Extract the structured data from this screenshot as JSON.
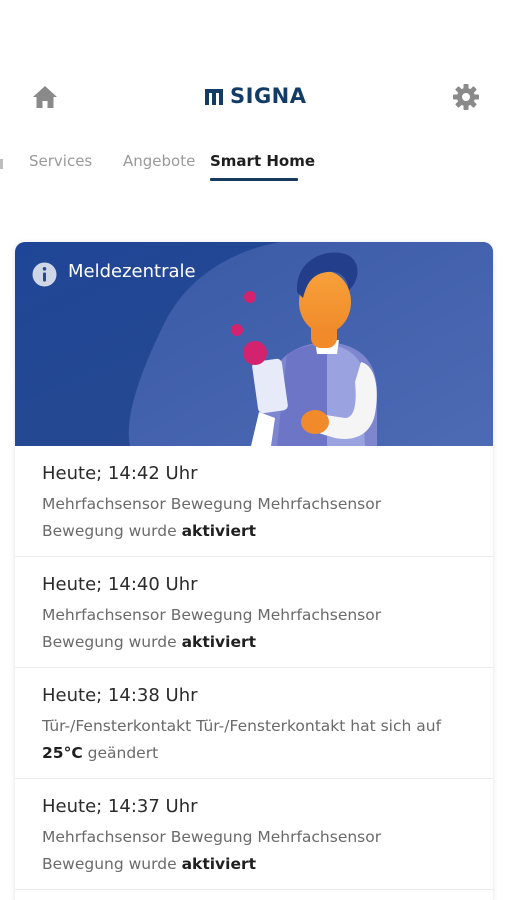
{
  "header": {
    "brand": "SIGNA",
    "home_icon": "home-icon",
    "settings_icon": "gear-icon",
    "brand_color": "#123c66"
  },
  "tabs": [
    {
      "label": "Services",
      "active": false
    },
    {
      "label": "Angebote",
      "active": false
    },
    {
      "label": "Smart Home",
      "active": true
    }
  ],
  "card": {
    "title": "Meldezentrale",
    "title_icon": "info-icon",
    "banner_color": "#2a4a8e"
  },
  "notifications": [
    {
      "time": "Heute; 14:42 Uhr",
      "text": "Mehrfachsensor Bewegung Mehrfachsensor Bewegung wurde",
      "highlight": "aktiviert",
      "suffix": ""
    },
    {
      "time": "Heute; 14:40 Uhr",
      "text": "Mehrfachsensor Bewegung Mehrfachsensor Bewegung wurde",
      "highlight": "aktiviert",
      "suffix": ""
    },
    {
      "time": "Heute; 14:38 Uhr",
      "text": "Tür-/Fensterkontakt Tür-/Fensterkontakt hat sich auf",
      "highlight": "25°C",
      "suffix": "geändert"
    },
    {
      "time": "Heute; 14:37 Uhr",
      "text": "Mehrfachsensor Bewegung Mehrfachsensor Bewegung wurde",
      "highlight": "aktiviert",
      "suffix": ""
    }
  ]
}
